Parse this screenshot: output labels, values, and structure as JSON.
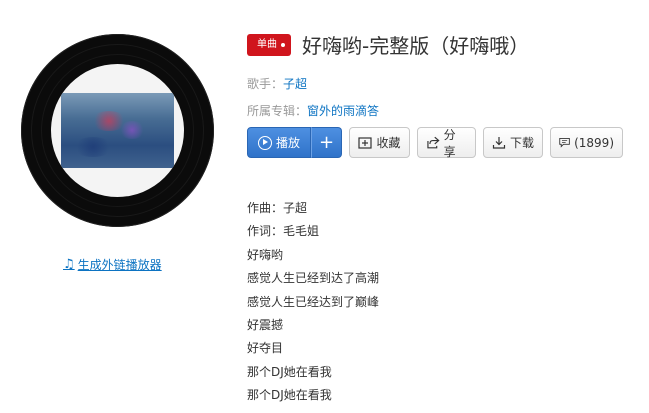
{
  "album": {
    "ext_link_label": "生成外链播放器",
    "music_icon": "music-note-icon"
  },
  "song": {
    "badge": "单曲",
    "title": "好嗨哟-完整版（好嗨哦）",
    "singer_label": "歌手：",
    "singer": "子超",
    "album_label": "所属专辑：",
    "album": "窗外的雨滴答"
  },
  "actions": {
    "play_label": "播放",
    "add_label": "+",
    "favorite_label": "收藏",
    "share_label": "分享",
    "download_label": "下载",
    "comment_label": "(1899)"
  },
  "colors": {
    "accent_blue": "#2f73c9",
    "badge_red": "#d0151d",
    "link_blue": "#0c73c2"
  },
  "lyrics": [
    "作曲：子超",
    "作词：毛毛姐",
    "好嗨哟",
    "感觉人生已经到达了高潮",
    "感觉人生已经达到了巅峰",
    "好震撼",
    "好夺目",
    "那个DJ她在看我",
    "那个DJ她在看我"
  ]
}
